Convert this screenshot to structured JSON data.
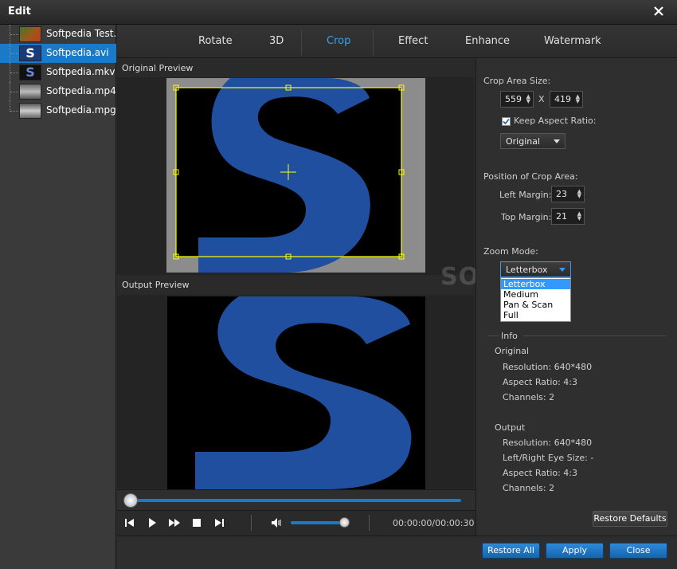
{
  "window": {
    "title": "Edit"
  },
  "files": [
    {
      "label": "Softpedia Test..."
    },
    {
      "label": "Softpedia.avi"
    },
    {
      "label": "Softpedia.mkv"
    },
    {
      "label": "Softpedia.mp4"
    },
    {
      "label": "Softpedia.mpg"
    }
  ],
  "tabs": {
    "rotate": "Rotate",
    "3d": "3D",
    "crop": "Crop",
    "effect": "Effect",
    "enhance": "Enhance",
    "watermark": "Watermark"
  },
  "preview": {
    "original_label": "Original Preview",
    "output_label": "Output Preview"
  },
  "player": {
    "time": "00:00:00/00:00:30",
    "progress": 0.0,
    "volume": 0.95
  },
  "crop": {
    "area_size_label": "Crop Area Size:",
    "width": "559",
    "x_sep": "X",
    "height": "419",
    "keep_aspect_label": "Keep Aspect Ratio:",
    "keep_aspect_checked": true,
    "aspect_value": "Original",
    "position_label": "Position of Crop Area:",
    "left_margin_label": "Left Margin:",
    "left_margin": "23",
    "top_margin_label": "Top Margin:",
    "top_margin": "21",
    "zoom_label": "Zoom Mode:",
    "zoom_value": "Letterbox",
    "zoom_options": [
      "Letterbox",
      "Medium",
      "Pan & Scan",
      "Full"
    ]
  },
  "info": {
    "heading": "Info",
    "original_heading": "Original",
    "original_resolution": "Resolution: 640*480",
    "original_aspect": "Aspect Ratio: 4:3",
    "original_channels": "Channels: 2",
    "output_heading": "Output",
    "output_resolution": "Resolution: 640*480",
    "output_eye": "Left/Right Eye Size: -",
    "output_aspect": "Aspect Ratio: 4:3",
    "output_channels": "Channels: 2"
  },
  "buttons": {
    "restore_defaults": "Restore Defaults",
    "restore_all": "Restore All",
    "apply": "Apply",
    "close": "Close"
  },
  "watermark_text": "SOFTPEDIA",
  "colors": {
    "accent": "#1b7ac8",
    "active_tab": "#3aa0e8",
    "crop_frame": "#ffff00",
    "logo_blue": "#1f4f9e"
  }
}
